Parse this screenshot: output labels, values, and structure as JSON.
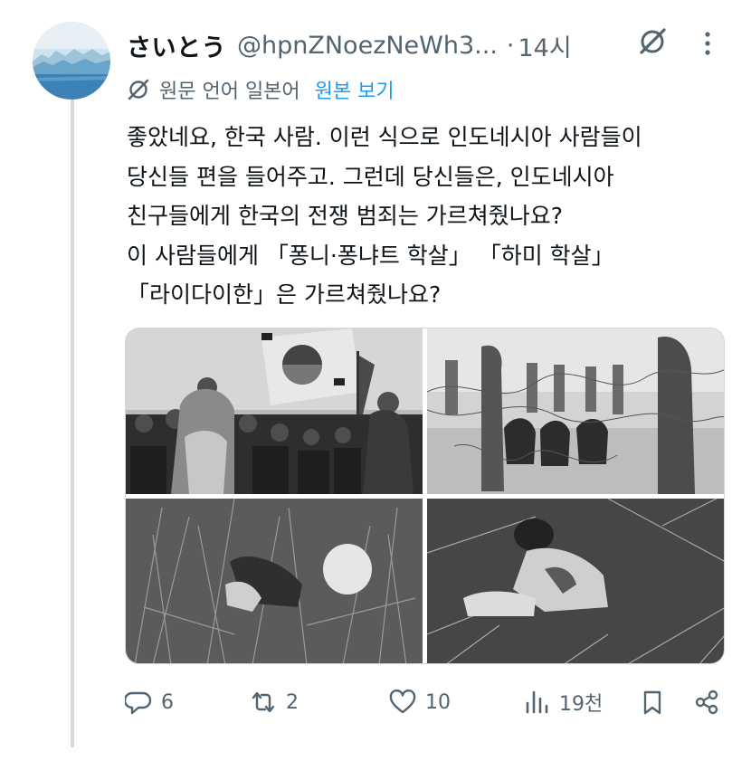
{
  "post": {
    "author_name": "さいとう",
    "author_handle": "@hpnZNoezNeWh3...",
    "separator": "·",
    "time": "14시",
    "translation": {
      "language_label": "원문 언어 일본어",
      "show_original_label": "원본 보기"
    },
    "text_lines": [
      "좋았네요, 한국 사람. 이런 식으로 인도네시아 사람들이",
      "당신들 편을 들어주고. 그런데 당신들은, 인도네시아",
      "친구들에게 한국의 전쟁 범죄는 가르쳐줬나요?",
      "이 사람들에게 「퐁니·퐁냐트 학살」 「하미 학살」",
      "「라이다이한」은 가르쳐줬나요?"
    ]
  },
  "actions": {
    "replies": "6",
    "reposts": "2",
    "likes": "10",
    "views": "19천"
  },
  "icons": {
    "avatar": "glacier-photo",
    "grok": "grok-icon",
    "more": "more-vertical-icon",
    "reply": "reply-icon",
    "repost": "repost-icon",
    "like": "heart-icon",
    "views": "views-icon",
    "bookmark": "bookmark-icon",
    "share": "share-icon"
  },
  "colors": {
    "accent": "#1d9bf0",
    "secondary_text": "#536471",
    "thread_line": "#cfd9de"
  }
}
